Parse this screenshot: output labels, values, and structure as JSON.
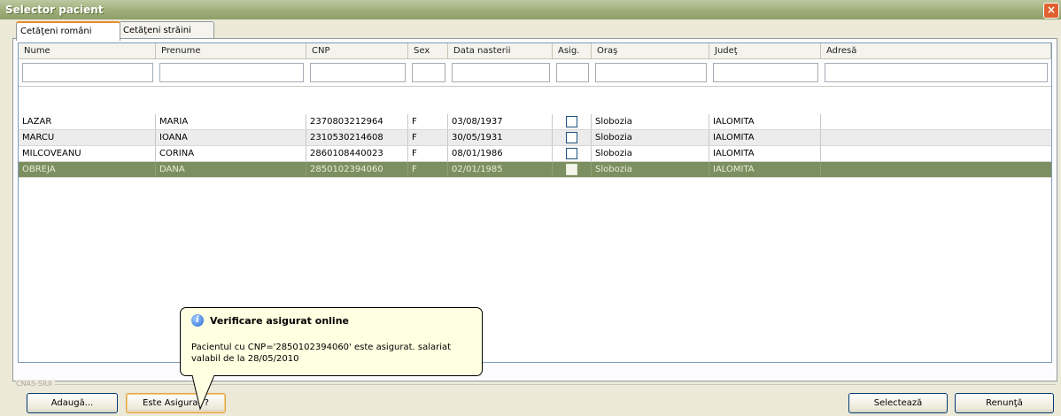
{
  "window": {
    "title": "Selector pacient",
    "close_glyph": "×"
  },
  "tabs": [
    {
      "label": "Cetăţeni români",
      "active": true
    },
    {
      "label": "Cetăţeni străini",
      "active": false
    }
  ],
  "grid": {
    "columns": [
      "Nume",
      "Prenume",
      "CNP",
      "Sex",
      "Data nasterii",
      "Asig.",
      "Oraş",
      "Judeţ",
      "Adresă"
    ],
    "rows": [
      {
        "nume": "LAZAR",
        "prenume": "MARIA",
        "cnp": "2370803212964",
        "sex": "F",
        "data": "03/08/1937",
        "asig": false,
        "oras": "Slobozia",
        "judet": "IALOMITA",
        "adresa": ""
      },
      {
        "nume": "MARCU",
        "prenume": "IOANA",
        "cnp": "2310530214608",
        "sex": "F",
        "data": "30/05/1931",
        "asig": false,
        "oras": "Slobozia",
        "judet": "IALOMITA",
        "adresa": ""
      },
      {
        "nume": "MILCOVEANU",
        "prenume": "CORINA",
        "cnp": "2860108440023",
        "sex": "F",
        "data": "08/01/1986",
        "asig": false,
        "oras": "Slobozia",
        "judet": "IALOMITA",
        "adresa": ""
      },
      {
        "nume": "OBREJA",
        "prenume": "DANA",
        "cnp": "2850102394060",
        "sex": "F",
        "data": "02/01/1985",
        "asig": false,
        "oras": "Slobozia",
        "judet": "IALOMITA",
        "adresa": ""
      }
    ],
    "selected_row": 3
  },
  "group_label": "CNAS-SIUI",
  "buttons": {
    "add": "Adaugă...",
    "insured": "Este Asigurat ?",
    "select": "Selectează",
    "cancel": "Renunţă"
  },
  "tooltip": {
    "title": "Verificare asigurat online",
    "body": "Pacientul cu CNP='2850102394060' este asigurat. salariat valabil de la 28/05/2010",
    "icon": "info-icon"
  },
  "colors": {
    "title_bar": "#9eae7a",
    "selected_row": "#7c8f60",
    "tooltip_bg": "#ffffe1",
    "tab_accent": "#e68b2c"
  }
}
